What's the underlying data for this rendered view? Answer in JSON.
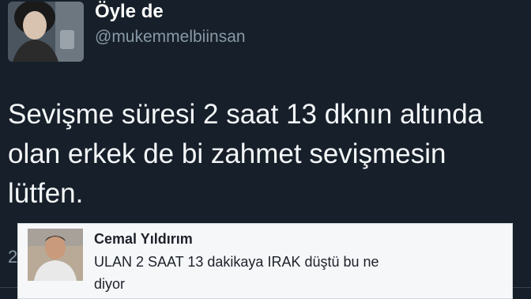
{
  "tweet": {
    "display_name": "Öyle de",
    "handle": "@mukemmelbiinsan",
    "text_lines": [
      "Sevişme süresi 2 saat 13 dknın altında",
      "olan erkek de bi zahmet sevişmesin",
      "lütfen."
    ],
    "footer_partial": "2"
  },
  "comment": {
    "author": "Cemal Yıldırım",
    "text_lines": [
      "ULAN 2 SAAT 13 dakikaya IRAK düştü bu ne",
      "diyor"
    ]
  },
  "colors": {
    "tweet_background": "#17202a",
    "tweet_text": "#f5f8fa",
    "handle_text": "#8899a6",
    "comment_background": "#f6f7f9",
    "comment_text": "#1d2129"
  }
}
